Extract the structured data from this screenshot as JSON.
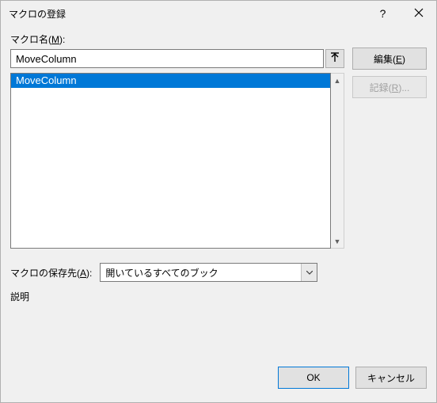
{
  "titlebar": {
    "title": "マクロの登録"
  },
  "labels": {
    "macro_name_pre": "マクロ名(",
    "macro_name_u": "M",
    "macro_name_post": "):",
    "storage_pre": "マクロの保存先(",
    "storage_u": "A",
    "storage_post": "):",
    "description": "説明"
  },
  "macro_name_value": "MoveColumn",
  "macro_list": [
    {
      "label": "MoveColumn",
      "selected": true
    }
  ],
  "buttons": {
    "edit_pre": "編集(",
    "edit_u": "E",
    "edit_post": ")",
    "record_pre": "記録(",
    "record_u": "R",
    "record_post": ")...",
    "ok": "OK",
    "cancel": "キャンセル"
  },
  "storage_selected": "開いているすべてのブック"
}
